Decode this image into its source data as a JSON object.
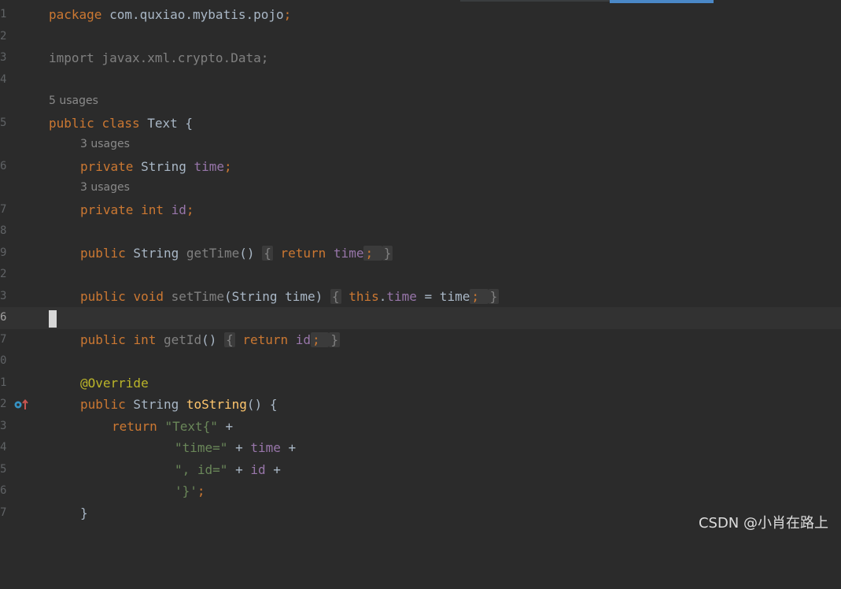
{
  "gutter": [
    "1",
    "2",
    "3",
    "4",
    "",
    "5",
    "",
    "6",
    "",
    "7",
    "8",
    "9",
    "2",
    "3",
    "6",
    "7",
    "0",
    "1",
    "2",
    "3",
    "4",
    "5",
    "6",
    "7"
  ],
  "code": {
    "package_kw": "package",
    "package_name": " com.quxiao.mybatis.pojo",
    "semi": ";",
    "import_stmt": "import javax.xml.crypto.Data;",
    "hint_class": "5 usages",
    "public_kw": "public",
    "class_kw": "class",
    "class_name": " Text {",
    "hint_time": "3 usages",
    "private_kw": "private",
    "string_type": " String ",
    "time_field": "time",
    "hint_id": "3 usages",
    "int_type": "int",
    "id_field": "id",
    "get_time_sig": "getTime",
    "parens": "()",
    "return_kw": "return",
    "void_kw": "void",
    "set_time_sig": "setTime",
    "set_time_params": "(String time)",
    "this_kw": "this",
    "assign": " = time",
    "get_id_sig": "getId",
    "override_ann": "@Override",
    "to_string_fn": "toString",
    "to_string_tail": "() {",
    "str_text": "\"Text{\"",
    "str_time": "\"time=\"",
    "str_id": "\", id=\"",
    "str_close": "'}'",
    "plus": " +",
    "close_brace": "}"
  },
  "watermark": "CSDN @小肖在路上"
}
